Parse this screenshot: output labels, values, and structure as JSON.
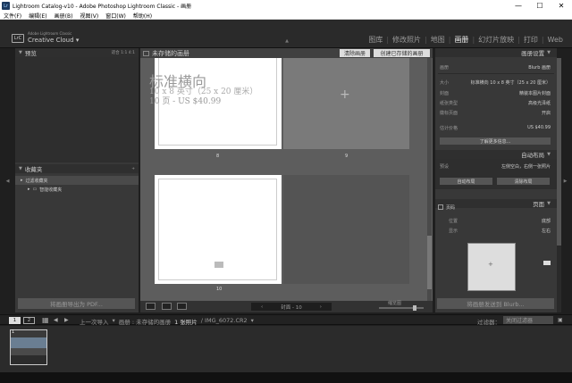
{
  "window": {
    "title": "Lightroom Catalog-v10 - Adobe Photoshop Lightroom Classic - 画册",
    "minimize": "—",
    "maximize": "☐",
    "close": "✕",
    "lr_icon": "Lr"
  },
  "menu": [
    "文件(F)",
    "编辑(E)",
    "画册(B)",
    "视图(V)",
    "窗口(W)",
    "帮助(H)"
  ],
  "identity": {
    "logo": "LrC",
    "line1": "Adobe Lightroom Classic",
    "line2": "Creative Cloud"
  },
  "modules": [
    "图库",
    "修改照片",
    "地图",
    "画册",
    "幻灯片放映",
    "打印",
    "Web"
  ],
  "active_module": "画册",
  "left": {
    "preview_header": "预览",
    "preview_extras": "适合  1:1  4:1",
    "collections_header": "收藏夹",
    "filter_collection": "过滤收藏夹",
    "smart_collections": "智能收藏夹",
    "export_pdf": "将画册导出为 PDF..."
  },
  "center": {
    "unsaved_book": "未存储的画册",
    "clear_book": "清除画册",
    "create_saved_book": "创建已存储的画册",
    "book_title": "标准横向",
    "book_size": "10 x 8 英寸（25 x 20 厘米）",
    "book_pages": "10 页 - US $40.99",
    "page_numbers": [
      "8",
      "9",
      "10"
    ],
    "page_nav": "封面 - 10",
    "thumbnails_label": "缩览图"
  },
  "right": {
    "book_settings_header": "画册设置",
    "book_label": "画册",
    "book_value": "Blurb 画册",
    "rows": [
      {
        "k": "大小",
        "v": "标准横向 10 x 8 英寸（25 x 20 厘米）"
      },
      {
        "k": "封面",
        "v": "精装本图片封面"
      },
      {
        "k": "纸张类型",
        "v": "高级光泽纸"
      },
      {
        "k": "徽标页面",
        "v": "开启"
      }
    ],
    "estimated_price_label": "估计价格",
    "estimated_price": "US $40.99",
    "learn_more": "了解更多信息...",
    "auto_layout_header": "自动布局",
    "preset_label": "预设",
    "preset_value": "左侧空白，右侧一张照片",
    "auto_layout_btn": "自动布局",
    "clear_layout_btn": "清除布局",
    "page_header": "页面",
    "page_number_label": "页码",
    "position_label": "位置",
    "position_value": "底部",
    "display_label": "显示",
    "display_value": "左右",
    "send_blurb": "将画册发送到 Blurb..."
  },
  "filmbar": {
    "page1": "1",
    "page2": "2",
    "source": "上一次导入",
    "path": "画册 : 未存储的画册",
    "count": "1 张照片",
    "file": "/ IMG_6072.CR2",
    "filter_label": "过滤器：",
    "filter_value": "关闭过滤器"
  },
  "thumb_number": "1",
  "colors": {
    "accent": "#ffffff",
    "panel": "#383838",
    "center": "#5d5d5d"
  }
}
